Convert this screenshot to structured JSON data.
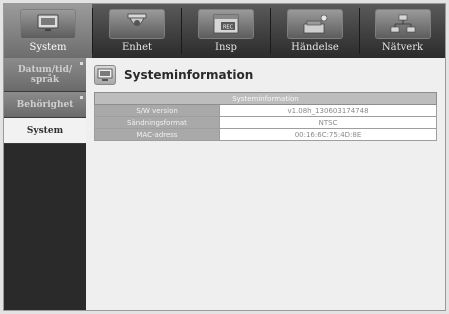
{
  "menu": {
    "tabs": [
      {
        "label": "System",
        "icon": "monitor-icon",
        "active": true
      },
      {
        "label": "Enhet",
        "icon": "camera-icon",
        "active": false
      },
      {
        "label": "Insp",
        "icon": "rec-icon",
        "active": false
      },
      {
        "label": "Händelse",
        "icon": "alarm-icon",
        "active": false
      },
      {
        "label": "Nätverk",
        "icon": "network-icon",
        "active": false
      }
    ]
  },
  "sidebar": {
    "items": [
      {
        "label": "Datum/tid/ språk",
        "active": false
      },
      {
        "label": "Behörighet",
        "active": false
      },
      {
        "label": "System",
        "active": true
      }
    ]
  },
  "page": {
    "title": "Systeminformation",
    "icon": "monitor-icon"
  },
  "table": {
    "header": "Systeminformation",
    "rows": [
      {
        "key": "S/W version",
        "value": "v1.08h_130603174748"
      },
      {
        "key": "Sändningsformat",
        "value": "NTSC"
      },
      {
        "key": "MAC-adress",
        "value": "00:16:6C:75:4D:8E"
      }
    ]
  }
}
